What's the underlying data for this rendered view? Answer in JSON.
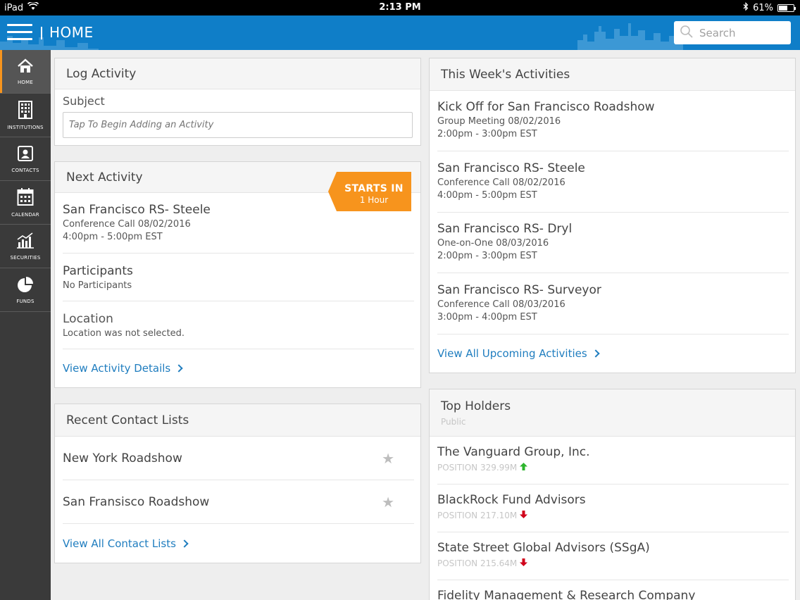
{
  "status_bar": {
    "device": "iPad",
    "time": "2:13 PM",
    "battery": "61%"
  },
  "header": {
    "title": "HOME",
    "search_placeholder": "Search"
  },
  "sidebar": {
    "items": [
      {
        "label": "HOME",
        "icon": "home-icon",
        "active": true
      },
      {
        "label": "INSTITUTIONS",
        "icon": "building-icon",
        "active": false
      },
      {
        "label": "CONTACTS",
        "icon": "contact-card-icon",
        "active": false
      },
      {
        "label": "CALENDAR",
        "icon": "calendar-icon",
        "active": false
      },
      {
        "label": "SECURITIES",
        "icon": "bar-chart-icon",
        "active": false
      },
      {
        "label": "FUNDS",
        "icon": "pie-chart-icon",
        "active": false
      }
    ]
  },
  "log_activity": {
    "title": "Log Activity",
    "subject_label": "Subject",
    "subject_placeholder": "Tap To Begin Adding an Activity"
  },
  "next_activity": {
    "title": "Next Activity",
    "badge_line1": "STARTS IN",
    "badge_line2": "1 Hour",
    "activity_title": "San Francisco RS- Steele",
    "activity_type": "Conference Call 08/02/2016",
    "activity_time": "4:00pm - 5:00pm EST",
    "participants_label": "Participants",
    "participants_value": "No Participants",
    "location_label": "Location",
    "location_value": "Location was not selected.",
    "details_link": "View Activity Details"
  },
  "recent_lists": {
    "title": "Recent Contact Lists",
    "items": [
      {
        "name": "New York Roadshow"
      },
      {
        "name": "San Fransisco Roadshow"
      }
    ],
    "view_all": "View All Contact Lists"
  },
  "week_activities": {
    "title": "This Week's Activities",
    "items": [
      {
        "title": "Kick Off for San Francisco Roadshow",
        "type": "Group Meeting 08/02/2016",
        "time": "2:00pm - 3:00pm EST"
      },
      {
        "title": "San Francisco RS- Steele",
        "type": "Conference Call 08/02/2016",
        "time": "4:00pm - 5:00pm EST"
      },
      {
        "title": "San Francisco RS- Dryl",
        "type": "One-on-One 08/03/2016",
        "time": "2:00pm - 3:00pm EST"
      },
      {
        "title": "San Francisco RS- Surveyor",
        "type": "Conference Call 08/03/2016",
        "time": "3:00pm - 4:00pm EST"
      }
    ],
    "view_all": "View All Upcoming Activities"
  },
  "top_holders": {
    "title": "Top Holders",
    "subtitle": "Public",
    "items": [
      {
        "name": "The Vanguard Group, Inc.",
        "position": "POSITION 329.99M",
        "trend": "up"
      },
      {
        "name": "BlackRock Fund Advisors",
        "position": "POSITION 217.10M",
        "trend": "down"
      },
      {
        "name": "State Street Global Advisors (SSgA)",
        "position": "POSITION 215.64M",
        "trend": "down"
      },
      {
        "name": "Fidelity Management & Research Company",
        "position": "",
        "trend": ""
      }
    ]
  },
  "colors": {
    "brand_blue": "#0f7ec8",
    "accent_orange": "#f7941d",
    "sidebar": "#3a3a3a",
    "link": "#1f7dbf",
    "up": "#2db52d",
    "down": "#d0021b"
  }
}
